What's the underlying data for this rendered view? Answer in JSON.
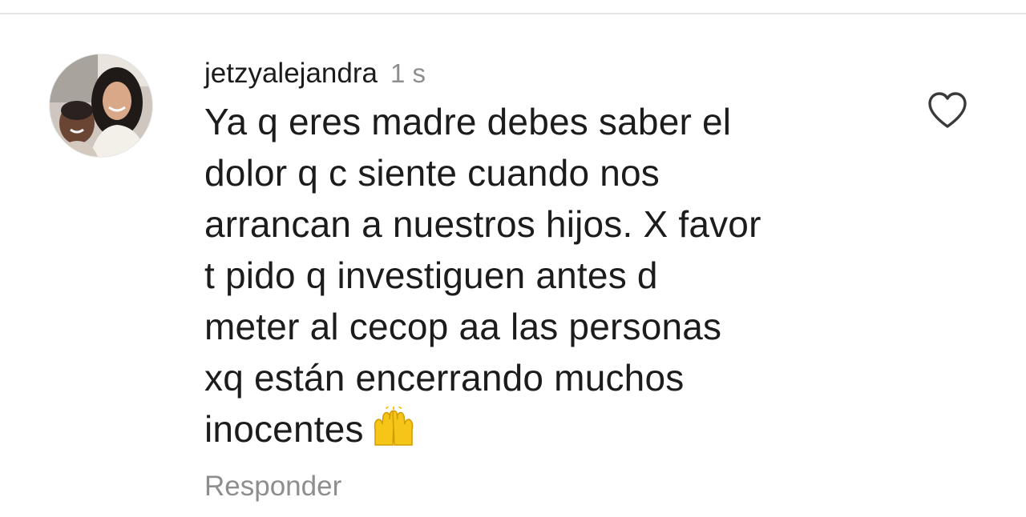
{
  "comment": {
    "username": "jetzyalejandra",
    "timestamp": "1 s",
    "text": "Ya q eres madre debes saber el\ndolor q c siente cuando nos\narrancan a nuestros hijos. X favor\nt pido q investiguen antes d\nmeter al cecop aa las personas\nxq están encerrando muchos\ninocentes",
    "emoji": "raising-hands",
    "reply_label": "Responder",
    "liked": false
  },
  "icons": {
    "like": "heart-outline-icon",
    "avatar": "profile-photo"
  },
  "colors": {
    "text": "#1c1c1c",
    "muted": "#8e8e8e",
    "divider": "#e6e6e6",
    "emoji": "#f5c518"
  }
}
